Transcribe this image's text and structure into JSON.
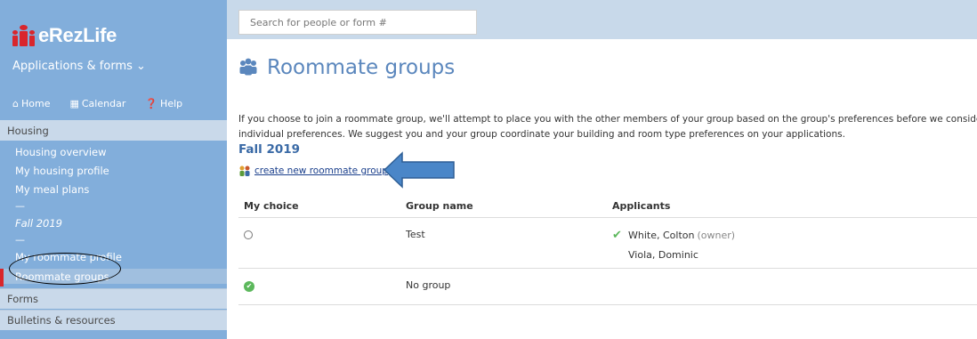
{
  "app": {
    "logo_text": "eRezLife"
  },
  "sidebar": {
    "menu_label": "Applications & forms",
    "menu_caret": "⌄",
    "nav": [
      {
        "icon": "home-icon",
        "glyph": "⌂",
        "label": "Home"
      },
      {
        "icon": "calendar-icon",
        "glyph": "▦",
        "label": "Calendar"
      },
      {
        "icon": "help-icon",
        "glyph": "❓",
        "label": "Help"
      }
    ],
    "housing_header": "Housing",
    "housing_items": [
      {
        "label": "Housing overview"
      },
      {
        "label": "My housing profile"
      },
      {
        "label": "My meal plans"
      },
      {
        "label": "—"
      },
      {
        "label": "Fall 2019"
      },
      {
        "label": "—"
      },
      {
        "label": "My roommate profile"
      },
      {
        "label": "Roommate groups",
        "active": true
      }
    ],
    "forms_header": "Forms",
    "bulletins_header": "Bulletins & resources"
  },
  "search": {
    "placeholder": "Search for people or form #"
  },
  "main": {
    "title": "Roommate groups",
    "intro_line1": "If you choose to join a roommate group, we'll attempt to place you with the other members of your group based on the group's preferences before we consider your",
    "intro_line2": "individual preferences. We suggest you and your group coordinate your building and room type preferences on your applications.",
    "term": "Fall 2019",
    "create_link": "create new roommate group",
    "table": {
      "headers": [
        "My choice",
        "Group name",
        "Applicants"
      ],
      "rows": [
        {
          "group_name": "Test",
          "selected": false,
          "applicants": [
            {
              "name": "White, Colton",
              "tag": "(owner)",
              "confirmed": true
            },
            {
              "name": "Viola, Dominic",
              "tag": "",
              "confirmed": false
            }
          ]
        },
        {
          "group_name": "No group",
          "selected": true,
          "applicants": []
        }
      ]
    }
  },
  "colors": {
    "sidebar_bg": "#82aedb",
    "accent_blue": "#5b87bd",
    "brand_red": "#d9262c",
    "check_green": "#5cb85c",
    "annotation_arrow": "#4a86c8"
  }
}
